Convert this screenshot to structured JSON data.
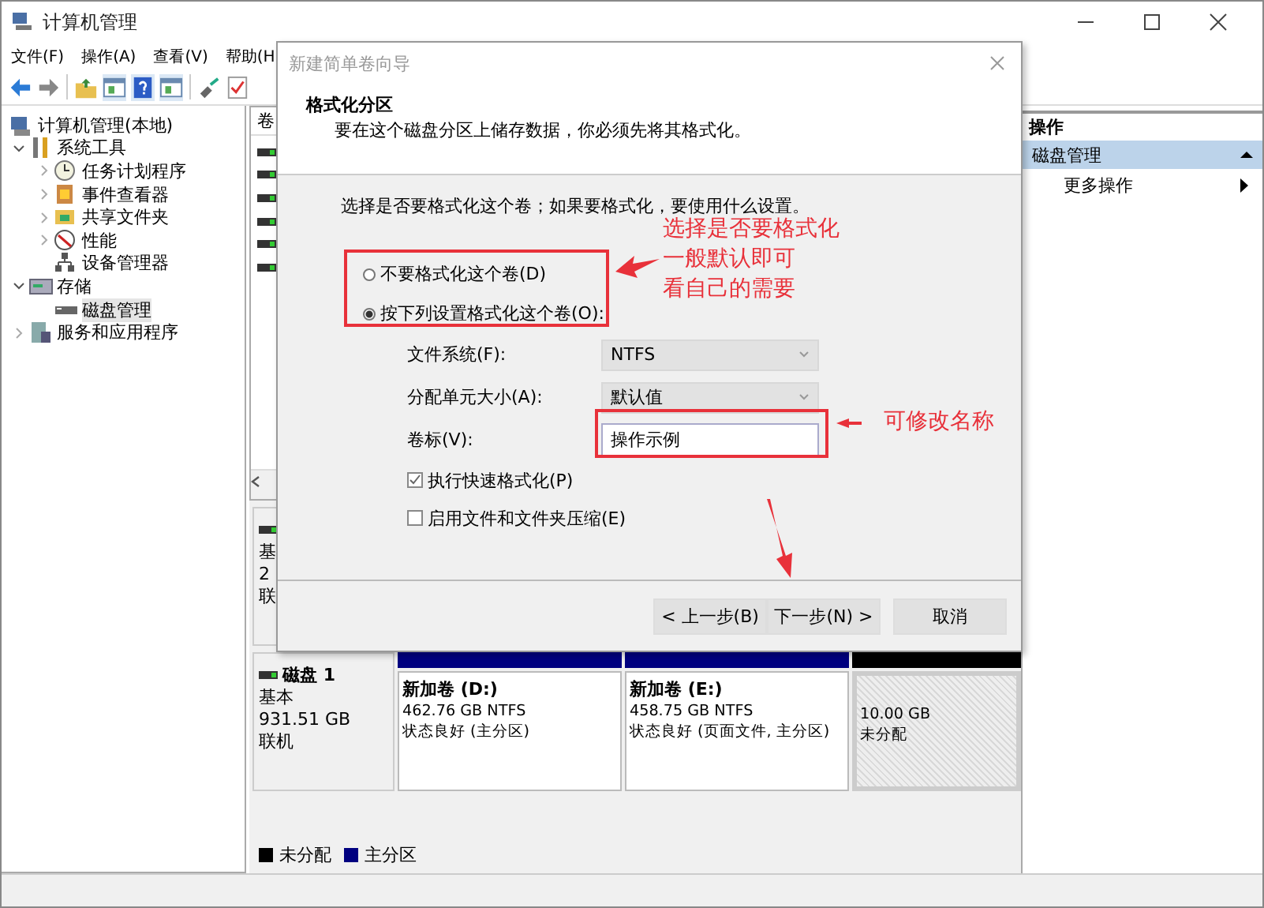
{
  "window": {
    "title": "计算机管理"
  },
  "menu": [
    {
      "label": "文件(F)"
    },
    {
      "label": "操作(A)"
    },
    {
      "label": "查看(V)"
    },
    {
      "label": "帮助(H"
    }
  ],
  "toolbar": [
    {
      "kind": "back"
    },
    {
      "kind": "forward"
    },
    {
      "kind": "up"
    },
    {
      "kind": "panel"
    },
    {
      "kind": "help"
    },
    {
      "kind": "panel"
    },
    {
      "kind": "connect"
    },
    {
      "kind": "check"
    }
  ],
  "tree": [
    {
      "label": "计算机管理(本地)",
      "kind": "computer",
      "selected": false,
      "children": [
        {
          "label": "系统工具",
          "kind": "tools",
          "expandable": true,
          "expanded": true,
          "selected": false,
          "children": [
            {
              "label": "任务计划程序",
              "kind": "clock",
              "expandable": true,
              "expanded": false,
              "selected": false
            },
            {
              "label": "事件查看器",
              "kind": "log",
              "expandable": true,
              "expanded": false,
              "selected": false
            },
            {
              "label": "共享文件夹",
              "kind": "share",
              "expandable": true,
              "expanded": false,
              "selected": false
            },
            {
              "label": "性能",
              "kind": "gauge",
              "expandable": true,
              "expanded": false,
              "selected": false
            },
            {
              "label": "设备管理器",
              "kind": "devices",
              "expandable": false,
              "selected": false
            }
          ]
        },
        {
          "label": "存储",
          "kind": "storage",
          "expandable": true,
          "expanded": true,
          "selected": false,
          "children": [
            {
              "label": "磁盘管理",
              "kind": "disk",
              "expandable": false,
              "selected": true
            }
          ]
        },
        {
          "label": "服务和应用程序",
          "kind": "services",
          "expandable": true,
          "expanded": false,
          "selected": false
        }
      ]
    }
  ],
  "volume_list": {
    "column": "卷",
    "rows": [
      {
        "kind": "volume"
      },
      {
        "kind": "volume"
      },
      {
        "kind": "volume"
      },
      {
        "kind": "volume"
      },
      {
        "kind": "volume"
      },
      {
        "kind": "volume"
      }
    ]
  },
  "disks": [
    {
      "type": "基",
      "size": "2",
      "status": "联"
    },
    {
      "name": "磁盘 1",
      "type": "基本",
      "size": "931.51 GB",
      "status": "联机",
      "partitions": [
        {
          "kind": "primary",
          "name": "新加卷 (D:)",
          "size": "462.76 GB NTFS",
          "status": "状态良好 (主分区)"
        },
        {
          "kind": "primary",
          "name": "新加卷 (E:)",
          "size": "458.75 GB NTFS",
          "status": "状态良好 (页面文件, 主分区)"
        },
        {
          "kind": "unallocated",
          "size": "10.00 GB",
          "status": "未分配"
        }
      ]
    }
  ],
  "legend": [
    {
      "label": "未分配",
      "color": "#000000"
    },
    {
      "label": "主分区",
      "color": "#000080"
    }
  ],
  "actions": {
    "title": "操作",
    "items": [
      {
        "kind": "section",
        "label": "磁盘管理",
        "expanded": true
      },
      {
        "kind": "submenu",
        "label": "更多操作"
      }
    ]
  },
  "dialog": {
    "title": "新建简单卷向导",
    "heading": "格式化分区",
    "subtitle": "要在这个磁盘分区上储存数据，你必须先将其格式化。",
    "prompt": "选择是否要格式化这个卷；如果要格式化，要使用什么设置。",
    "radios": [
      {
        "label": "不要格式化这个卷(D)",
        "selected": false
      },
      {
        "label": "按下列设置格式化这个卷(O):",
        "selected": true
      }
    ],
    "fields": [
      {
        "kind": "select",
        "label": "文件系统(F):",
        "value": "NTFS"
      },
      {
        "kind": "select",
        "label": "分配单元大小(A):",
        "value": "默认值"
      },
      {
        "kind": "text",
        "label": "卷标(V):",
        "value": "操作示例"
      }
    ],
    "checkboxes": [
      {
        "label": "执行快速格式化(P)",
        "checked": true
      },
      {
        "label": "启用文件和文件夹压缩(E)",
        "checked": false
      }
    ],
    "buttons": [
      {
        "kind": "back",
        "label": "< 上一步(B)"
      },
      {
        "kind": "next",
        "label": "下一步(N) >"
      },
      {
        "kind": "cancel",
        "label": "取消"
      }
    ]
  },
  "annotations": [
    {
      "kind": "note",
      "lines": [
        "选择是否要格式化",
        "一般默认即可",
        "看自己的需要"
      ]
    },
    {
      "kind": "note",
      "lines": [
        "可修改名称"
      ]
    }
  ]
}
